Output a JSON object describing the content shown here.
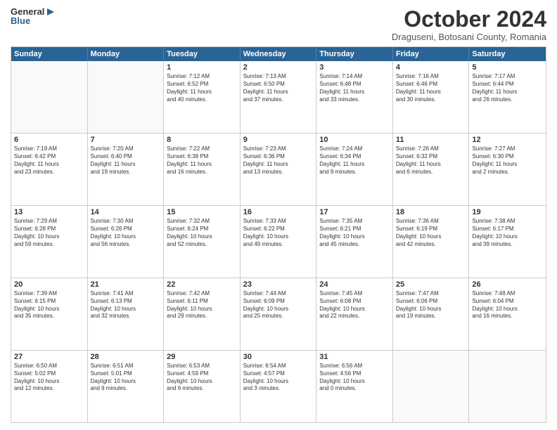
{
  "logo": {
    "general": "General",
    "blue": "Blue"
  },
  "title": "October 2024",
  "subtitle": "Draguseni, Botosani County, Romania",
  "weekdays": [
    "Sunday",
    "Monday",
    "Tuesday",
    "Wednesday",
    "Thursday",
    "Friday",
    "Saturday"
  ],
  "weeks": [
    [
      {
        "day": "",
        "lines": []
      },
      {
        "day": "",
        "lines": []
      },
      {
        "day": "1",
        "lines": [
          "Sunrise: 7:12 AM",
          "Sunset: 6:52 PM",
          "Daylight: 11 hours",
          "and 40 minutes."
        ]
      },
      {
        "day": "2",
        "lines": [
          "Sunrise: 7:13 AM",
          "Sunset: 6:50 PM",
          "Daylight: 11 hours",
          "and 37 minutes."
        ]
      },
      {
        "day": "3",
        "lines": [
          "Sunrise: 7:14 AM",
          "Sunset: 6:48 PM",
          "Daylight: 11 hours",
          "and 33 minutes."
        ]
      },
      {
        "day": "4",
        "lines": [
          "Sunrise: 7:16 AM",
          "Sunset: 6:46 PM",
          "Daylight: 11 hours",
          "and 30 minutes."
        ]
      },
      {
        "day": "5",
        "lines": [
          "Sunrise: 7:17 AM",
          "Sunset: 6:44 PM",
          "Daylight: 11 hours",
          "and 26 minutes."
        ]
      }
    ],
    [
      {
        "day": "6",
        "lines": [
          "Sunrise: 7:19 AM",
          "Sunset: 6:42 PM",
          "Daylight: 11 hours",
          "and 23 minutes."
        ]
      },
      {
        "day": "7",
        "lines": [
          "Sunrise: 7:20 AM",
          "Sunset: 6:40 PM",
          "Daylight: 11 hours",
          "and 19 minutes."
        ]
      },
      {
        "day": "8",
        "lines": [
          "Sunrise: 7:22 AM",
          "Sunset: 6:38 PM",
          "Daylight: 11 hours",
          "and 16 minutes."
        ]
      },
      {
        "day": "9",
        "lines": [
          "Sunrise: 7:23 AM",
          "Sunset: 6:36 PM",
          "Daylight: 11 hours",
          "and 13 minutes."
        ]
      },
      {
        "day": "10",
        "lines": [
          "Sunrise: 7:24 AM",
          "Sunset: 6:34 PM",
          "Daylight: 11 hours",
          "and 9 minutes."
        ]
      },
      {
        "day": "11",
        "lines": [
          "Sunrise: 7:26 AM",
          "Sunset: 6:32 PM",
          "Daylight: 11 hours",
          "and 6 minutes."
        ]
      },
      {
        "day": "12",
        "lines": [
          "Sunrise: 7:27 AM",
          "Sunset: 6:30 PM",
          "Daylight: 11 hours",
          "and 2 minutes."
        ]
      }
    ],
    [
      {
        "day": "13",
        "lines": [
          "Sunrise: 7:29 AM",
          "Sunset: 6:28 PM",
          "Daylight: 10 hours",
          "and 59 minutes."
        ]
      },
      {
        "day": "14",
        "lines": [
          "Sunrise: 7:30 AM",
          "Sunset: 6:26 PM",
          "Daylight: 10 hours",
          "and 56 minutes."
        ]
      },
      {
        "day": "15",
        "lines": [
          "Sunrise: 7:32 AM",
          "Sunset: 6:24 PM",
          "Daylight: 10 hours",
          "and 52 minutes."
        ]
      },
      {
        "day": "16",
        "lines": [
          "Sunrise: 7:33 AM",
          "Sunset: 6:22 PM",
          "Daylight: 10 hours",
          "and 49 minutes."
        ]
      },
      {
        "day": "17",
        "lines": [
          "Sunrise: 7:35 AM",
          "Sunset: 6:21 PM",
          "Daylight: 10 hours",
          "and 45 minutes."
        ]
      },
      {
        "day": "18",
        "lines": [
          "Sunrise: 7:36 AM",
          "Sunset: 6:19 PM",
          "Daylight: 10 hours",
          "and 42 minutes."
        ]
      },
      {
        "day": "19",
        "lines": [
          "Sunrise: 7:38 AM",
          "Sunset: 6:17 PM",
          "Daylight: 10 hours",
          "and 39 minutes."
        ]
      }
    ],
    [
      {
        "day": "20",
        "lines": [
          "Sunrise: 7:39 AM",
          "Sunset: 6:15 PM",
          "Daylight: 10 hours",
          "and 35 minutes."
        ]
      },
      {
        "day": "21",
        "lines": [
          "Sunrise: 7:41 AM",
          "Sunset: 6:13 PM",
          "Daylight: 10 hours",
          "and 32 minutes."
        ]
      },
      {
        "day": "22",
        "lines": [
          "Sunrise: 7:42 AM",
          "Sunset: 6:11 PM",
          "Daylight: 10 hours",
          "and 29 minutes."
        ]
      },
      {
        "day": "23",
        "lines": [
          "Sunrise: 7:44 AM",
          "Sunset: 6:09 PM",
          "Daylight: 10 hours",
          "and 25 minutes."
        ]
      },
      {
        "day": "24",
        "lines": [
          "Sunrise: 7:45 AM",
          "Sunset: 6:08 PM",
          "Daylight: 10 hours",
          "and 22 minutes."
        ]
      },
      {
        "day": "25",
        "lines": [
          "Sunrise: 7:47 AM",
          "Sunset: 6:06 PM",
          "Daylight: 10 hours",
          "and 19 minutes."
        ]
      },
      {
        "day": "26",
        "lines": [
          "Sunrise: 7:48 AM",
          "Sunset: 6:04 PM",
          "Daylight: 10 hours",
          "and 16 minutes."
        ]
      }
    ],
    [
      {
        "day": "27",
        "lines": [
          "Sunrise: 6:50 AM",
          "Sunset: 5:02 PM",
          "Daylight: 10 hours",
          "and 12 minutes."
        ]
      },
      {
        "day": "28",
        "lines": [
          "Sunrise: 6:51 AM",
          "Sunset: 5:01 PM",
          "Daylight: 10 hours",
          "and 9 minutes."
        ]
      },
      {
        "day": "29",
        "lines": [
          "Sunrise: 6:53 AM",
          "Sunset: 4:59 PM",
          "Daylight: 10 hours",
          "and 6 minutes."
        ]
      },
      {
        "day": "30",
        "lines": [
          "Sunrise: 6:54 AM",
          "Sunset: 4:57 PM",
          "Daylight: 10 hours",
          "and 3 minutes."
        ]
      },
      {
        "day": "31",
        "lines": [
          "Sunrise: 6:56 AM",
          "Sunset: 4:56 PM",
          "Daylight: 10 hours",
          "and 0 minutes."
        ]
      },
      {
        "day": "",
        "lines": []
      },
      {
        "day": "",
        "lines": []
      }
    ]
  ]
}
